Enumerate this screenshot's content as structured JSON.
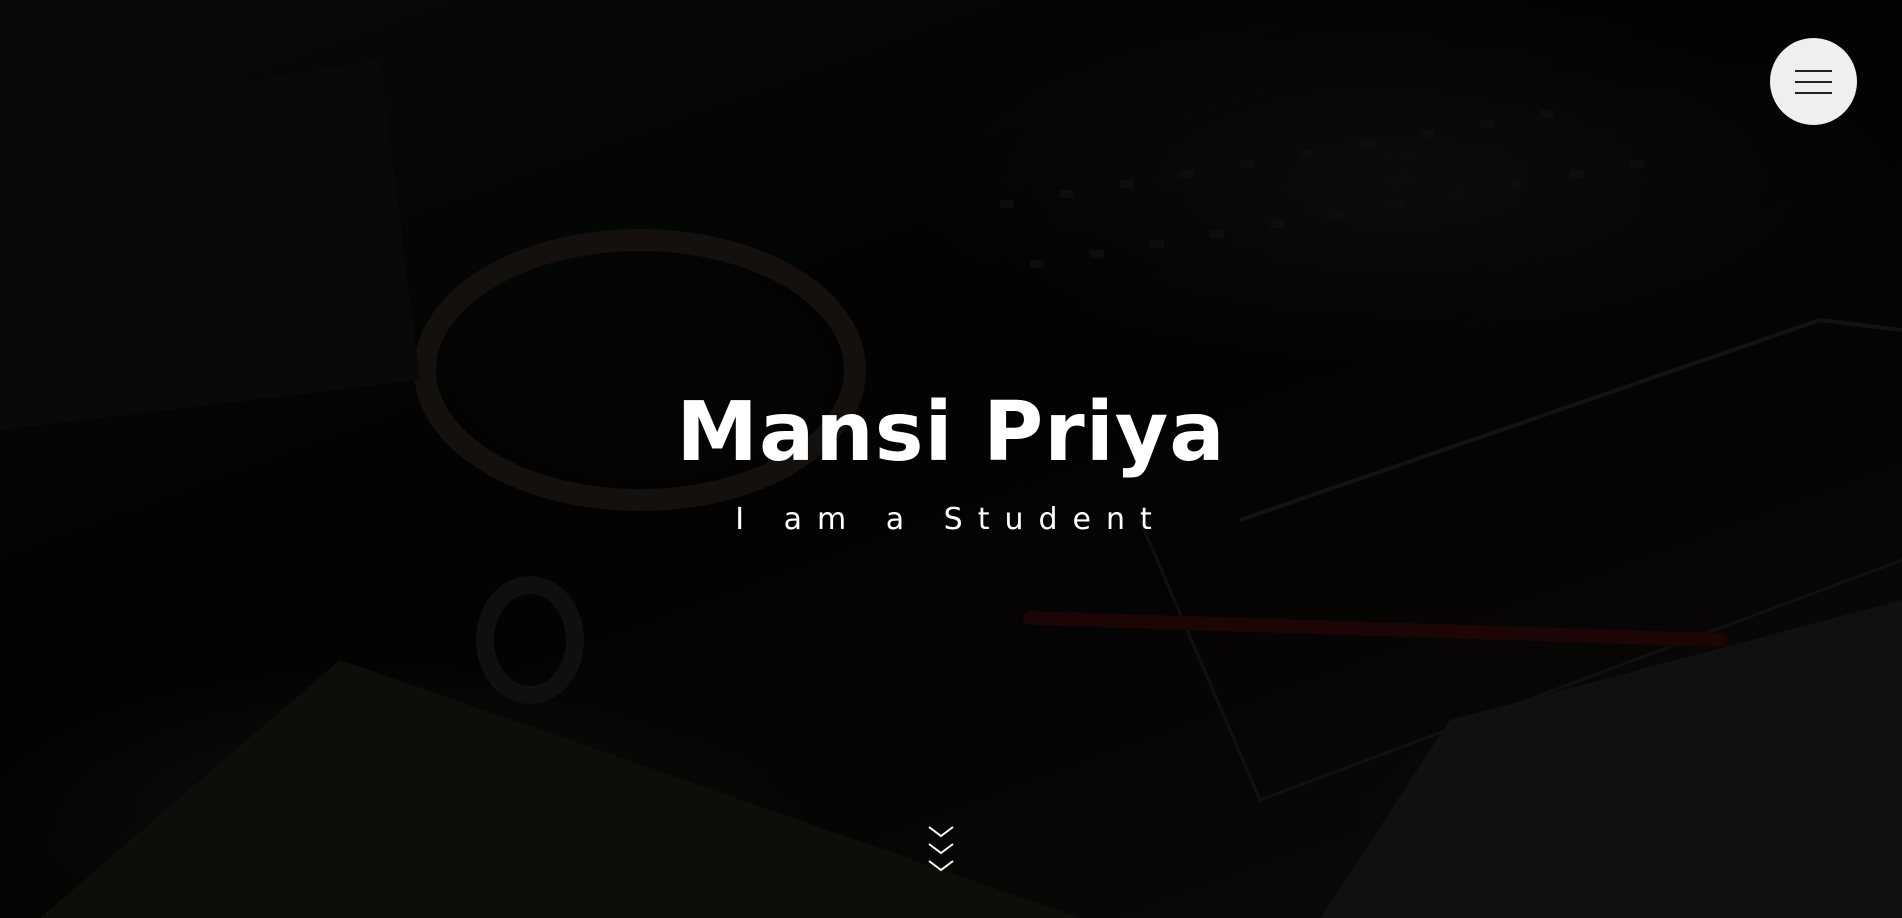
{
  "menu": {
    "icon": "hamburger-icon"
  },
  "hero": {
    "name": "Mansi Priya",
    "tagline": "I am a Student"
  },
  "scroll": {
    "icon": "chevrons-down-icon"
  },
  "colors": {
    "text": "#ffffff",
    "menu_button_bg": "#efefef",
    "background": "#050505"
  }
}
